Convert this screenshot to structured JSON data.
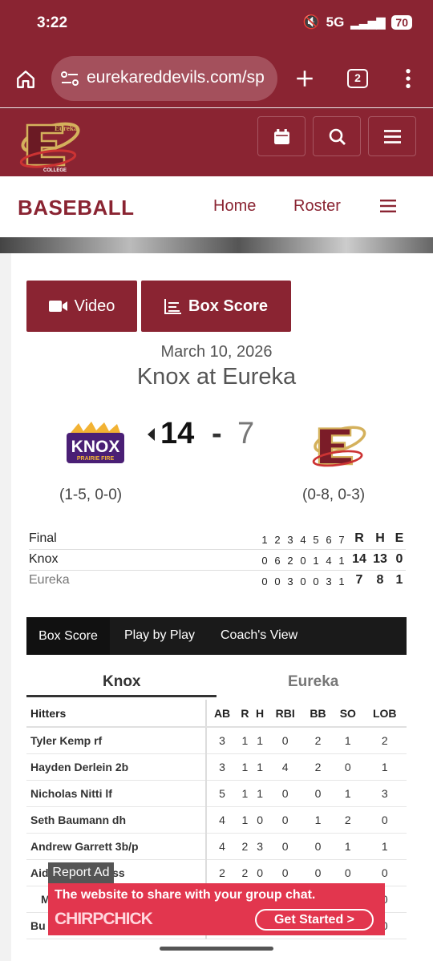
{
  "status": {
    "time": "3:22",
    "network": "5G",
    "battery": "70"
  },
  "browser": {
    "url": "eurekareddevils.com/sp",
    "tab_count": "2"
  },
  "site": {
    "logo_text_top": "Eureka",
    "logo_text_bottom": "COLLEGE"
  },
  "sport_nav": {
    "title": "BASEBALL",
    "home": "Home",
    "roster": "Roster"
  },
  "buttons": {
    "video": "Video",
    "box_score": "Box Score"
  },
  "game": {
    "date": "March 10, 2026",
    "matchup": "Knox at Eureka",
    "away": {
      "name": "Knox",
      "logo_text": "KNOX",
      "logo_sub": "PRAIRIE FIRE",
      "score": "14",
      "record": "(1-5, 0-0)"
    },
    "home": {
      "name": "Eureka",
      "score": "7",
      "record": "(0-8, 0-3)"
    },
    "dash": "-"
  },
  "linescore": {
    "status": "Final",
    "innings": [
      "1",
      "2",
      "3",
      "4",
      "5",
      "6",
      "7"
    ],
    "totals_headers": [
      "R",
      "H",
      "E"
    ],
    "rows": [
      {
        "team": "Knox",
        "innings": [
          "0",
          "6",
          "2",
          "0",
          "1",
          "4",
          "1"
        ],
        "totals": [
          "14",
          "13",
          "0"
        ]
      },
      {
        "team": "Eureka",
        "innings": [
          "0",
          "0",
          "3",
          "0",
          "0",
          "3",
          "1"
        ],
        "totals": [
          "7",
          "8",
          "1"
        ]
      }
    ]
  },
  "tabs": [
    "Box Score",
    "Play by Play",
    "Coach's View"
  ],
  "team_tabs": [
    "Knox",
    "Eureka"
  ],
  "boxscore": {
    "headers": [
      "Hitters",
      "AB",
      "R",
      "H",
      "RBI",
      "BB",
      "SO",
      "LOB"
    ],
    "rows": [
      {
        "name": "Tyler Kemp rf",
        "stats": [
          "3",
          "1",
          "1",
          "0",
          "2",
          "1",
          "2"
        ]
      },
      {
        "name": "Hayden Derlein 2b",
        "stats": [
          "3",
          "1",
          "1",
          "4",
          "2",
          "0",
          "1"
        ]
      },
      {
        "name": "Nicholas Nitti lf",
        "stats": [
          "5",
          "1",
          "1",
          "0",
          "0",
          "1",
          "3"
        ]
      },
      {
        "name": "Seth Baumann dh",
        "stats": [
          "4",
          "1",
          "0",
          "0",
          "1",
          "2",
          "0"
        ]
      },
      {
        "name": "Andrew Garrett 3b/p",
        "stats": [
          "4",
          "2",
          "3",
          "0",
          "0",
          "1",
          "1"
        ]
      },
      {
        "name": "Aid",
        "name_tail": "ie ss",
        "stats": [
          "2",
          "2",
          "0",
          "0",
          "0",
          "0",
          "0"
        ]
      },
      {
        "name": "M",
        "stats": [
          "",
          "",
          "",
          "",
          "",
          "",
          "0"
        ]
      },
      {
        "name": "Bu",
        "stats": [
          "",
          "",
          "",
          "",
          "",
          "",
          "0"
        ]
      }
    ]
  },
  "ad": {
    "label": "Report Ad",
    "text": "The website to share with your group chat.",
    "logo": "CHIRPCHICK",
    "cta": "Get Started >"
  }
}
